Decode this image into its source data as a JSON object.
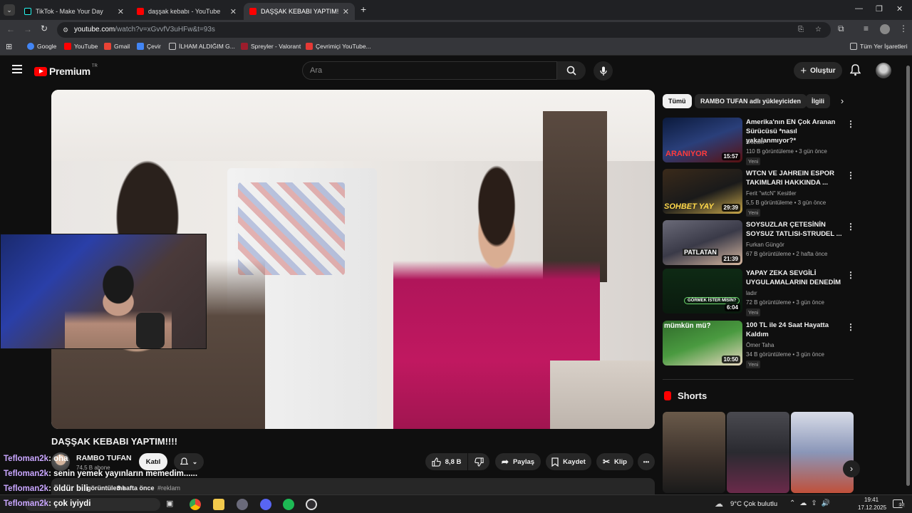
{
  "browser": {
    "tabs": [
      {
        "title": "TikTok - Make Your Day",
        "close": "✕"
      },
      {
        "title": "daşşak kebabı - YouTube",
        "close": "✕"
      },
      {
        "title": "DAŞŞAK KEBABI YAPTIM!!!! - Yo",
        "close": "✕"
      }
    ],
    "new_tab": "+",
    "window_controls": {
      "minimize": "—",
      "restore": "❐",
      "close": "✕"
    },
    "url_host": "youtube.com",
    "url_path": "/watch?v=xGvvfV3uHFw&t=93s",
    "bookmarks": [
      {
        "label": "Google",
        "color": "#4285f4"
      },
      {
        "label": "YouTube",
        "color": "#ff0000"
      },
      {
        "label": "Gmail",
        "color": "#ea4335"
      },
      {
        "label": "Çevir",
        "color": "#4285f4"
      },
      {
        "label": "İLHAM ALDIĞIM G...",
        "color": "#e8e8e8"
      },
      {
        "label": "Spreyler - Valorant",
        "color": "#9c1d2c"
      },
      {
        "label": "Çevrimiçi YouTube...",
        "color": "#e53935"
      }
    ],
    "all_bookmarks": "Tüm Yer İşaretleri"
  },
  "header": {
    "logo": "Premium",
    "logo_badge": "TR",
    "search_placeholder": "Ara",
    "create_label": "Oluştur"
  },
  "video": {
    "title": "DAŞŞAK KEBABI YAPTIM!!!!",
    "channel": "RAMBO TUFAN",
    "subscribers": "74,5 B abone",
    "join_label": "Katıl",
    "likes": "8,8 B",
    "share_label": "Paylaş",
    "save_label": "Kaydet",
    "clip_label": "Klip",
    "more_label": "•••",
    "desc_views": "görüntüleme",
    "desc_date": "3 hafta önce",
    "desc_tag": "#reklam"
  },
  "chat_overlay": [
    {
      "user": "Tefloman2k",
      "msg": ": oha"
    },
    {
      "user": "Tefloman2k",
      "msg": ": senin yemek yayınların memedim......"
    },
    {
      "user": "Tefloman2k",
      "msg": ": öldür bili"
    },
    {
      "user": "Tefloman2k",
      "msg": ": çok iyiydi"
    }
  ],
  "sidebar": {
    "chips": [
      "Tümü",
      "RAMBO TUFAN adlı yükleyiciden",
      "İlgili"
    ],
    "recommendations": [
      {
        "title": "Amerika'nın EN Çok Aranan Sürücüsü *nasıl yakalanmıyor?*",
        "channel": "Gözaltı",
        "meta": "110 B görüntüleme • 3 gün önce",
        "badge": "Yeni",
        "duration": "15:57",
        "thumb_text": "ARANIYOR",
        "thumb_color": "#1b2c55"
      },
      {
        "title": "WTCN VE JAHREIN ESPOR TAKIMLARI HAKKINDA ...",
        "channel": "Ferit \"wtcN\" Kesitler",
        "meta": "5,5 B görüntüleme • 3 gün önce",
        "badge": "Yeni",
        "duration": "29:39",
        "thumb_text": "SOHBET YAY",
        "thumb_color": "#1a1a1a"
      },
      {
        "title": "SOYSUZLAR ÇETESİNİN SOYSUZ TATLISI-STRUDEL ...",
        "channel": "Furkan Güngör",
        "meta": "67 B görüntüleme • 2 hafta önce",
        "badge": "",
        "duration": "21:39",
        "thumb_text": "PATLATAN",
        "thumb_color": "#3a3a48"
      },
      {
        "title": "YAPAY ZEKA SEVGİLİ UYGULAMALARINI DENEDİM",
        "channel": "ladır",
        "meta": "72 B görüntüleme • 3 gün önce",
        "badge": "Yeni",
        "duration": "6:04",
        "thumb_text": "GÖRMEK İSTER MİSİN?",
        "thumb_color": "#0e3a1a"
      },
      {
        "title": "100 TL ile 24 Saat Hayatta Kaldım",
        "channel": "Ömer Taha",
        "meta": "34 B görüntüleme • 3 gün önce",
        "badge": "Yeni",
        "duration": "10:50",
        "thumb_text": "mümkün mü?",
        "thumb_color": "#3f8a3a"
      }
    ],
    "shorts_title": "Shorts"
  },
  "taskbar": {
    "weather": "9°C  Çok bulutlu",
    "time": "19:41",
    "date": "17.12.2025",
    "notif_count": "10"
  }
}
